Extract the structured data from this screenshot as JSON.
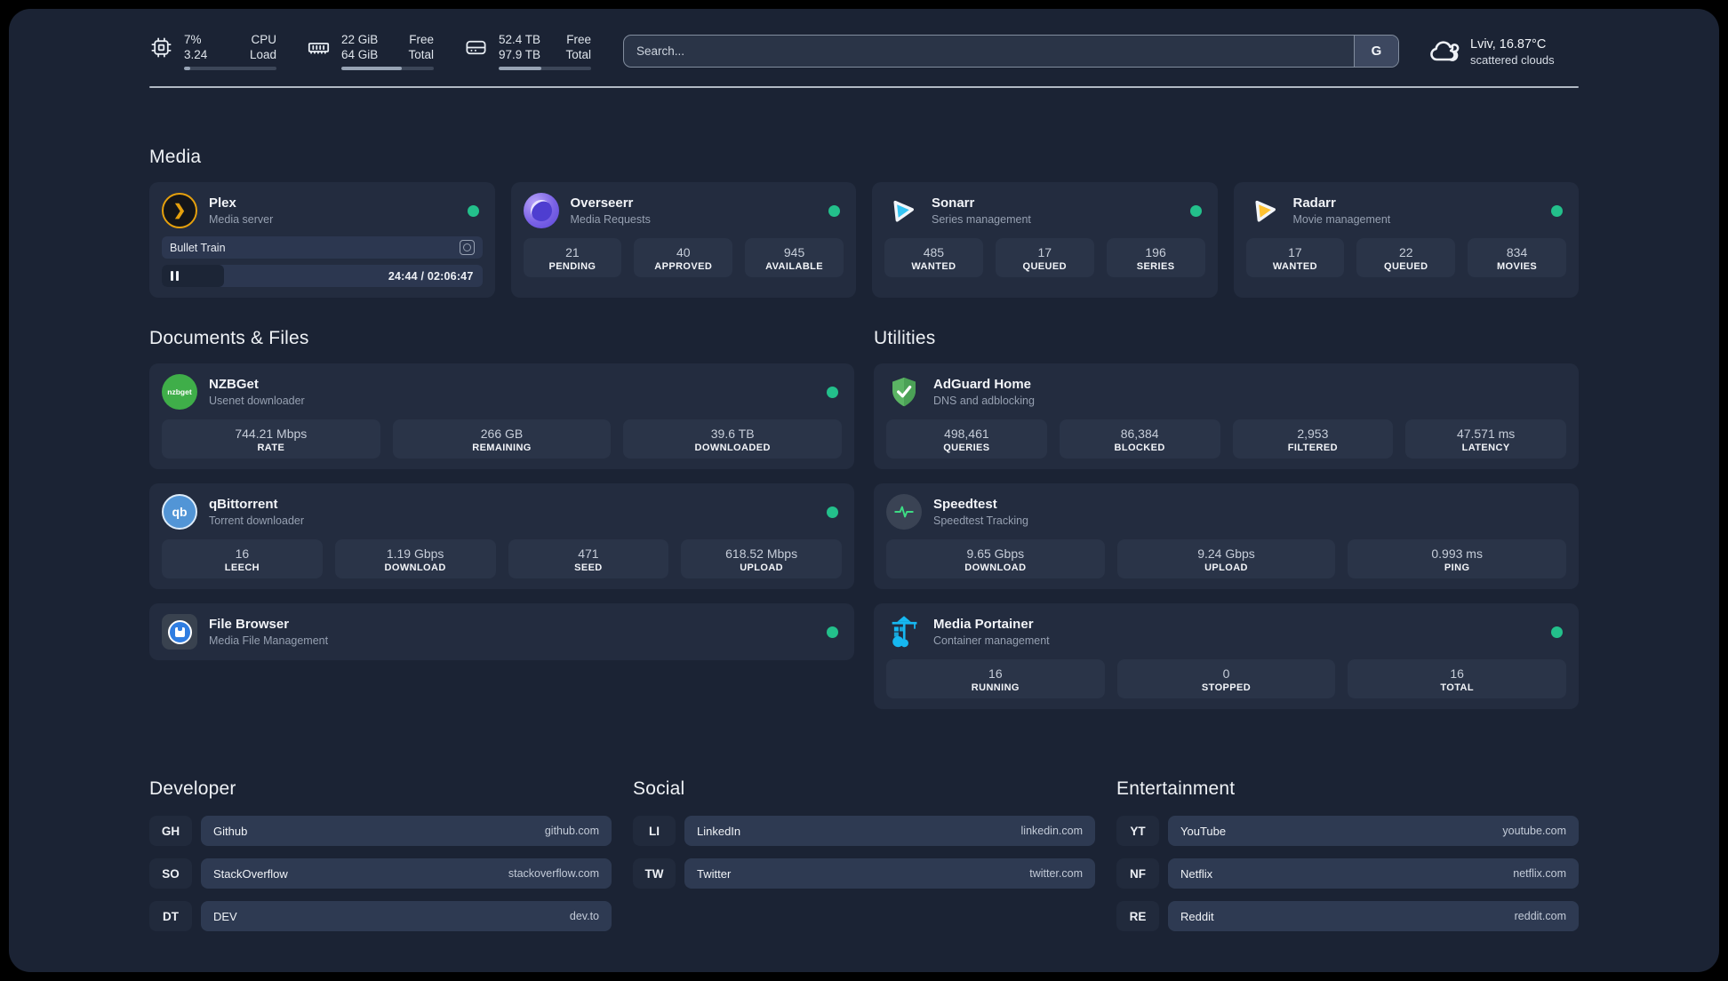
{
  "topbar": {
    "stats": [
      {
        "icon": "cpu-icon",
        "value_top": "7%",
        "value_bottom": "3.24",
        "label_top": "CPU",
        "label_bottom": "Load",
        "progress": 7
      },
      {
        "icon": "ram-icon",
        "value_top": "22 GiB",
        "value_bottom": "64 GiB",
        "label_top": "Free",
        "label_bottom": "Total",
        "progress": 65
      },
      {
        "icon": "disk-icon",
        "value_top": "52.4 TB",
        "value_bottom": "97.9 TB",
        "label_top": "Free",
        "label_bottom": "Total",
        "progress": 46
      }
    ],
    "search": {
      "placeholder": "Search...",
      "button_label": "G"
    },
    "weather": {
      "icon": "cloud-icon",
      "location": "Lviv, 16.87°C",
      "condition": "scattered clouds"
    }
  },
  "sections": {
    "media": {
      "title": "Media",
      "plex": {
        "icon": "plex-icon",
        "name": "Plex",
        "subtitle": "Media server",
        "status": "online",
        "now_playing": {
          "title": "Bullet Train",
          "time": "24:44 / 02:06:47",
          "progress": 19.5
        }
      },
      "overseerr": {
        "icon": "overseerr-icon",
        "name": "Overseerr",
        "subtitle": "Media Requests",
        "status": "online",
        "stats": [
          {
            "value": "21",
            "label": "PENDING"
          },
          {
            "value": "40",
            "label": "APPROVED"
          },
          {
            "value": "945",
            "label": "AVAILABLE"
          }
        ]
      },
      "sonarr": {
        "icon": "sonarr-icon",
        "name": "Sonarr",
        "subtitle": "Series management",
        "status": "online",
        "stats": [
          {
            "value": "485",
            "label": "WANTED"
          },
          {
            "value": "17",
            "label": "QUEUED"
          },
          {
            "value": "196",
            "label": "SERIES"
          }
        ]
      },
      "radarr": {
        "icon": "radarr-icon",
        "name": "Radarr",
        "subtitle": "Movie management",
        "status": "online",
        "stats": [
          {
            "value": "17",
            "label": "WANTED"
          },
          {
            "value": "22",
            "label": "QUEUED"
          },
          {
            "value": "834",
            "label": "MOVIES"
          }
        ]
      }
    },
    "documents": {
      "title": "Documents & Files",
      "nzbget": {
        "icon": "nzbget-icon",
        "icon_text": "nzbget",
        "name": "NZBGet",
        "subtitle": "Usenet downloader",
        "status": "online",
        "stats": [
          {
            "value": "744.21 Mbps",
            "label": "RATE"
          },
          {
            "value": "266 GB",
            "label": "REMAINING"
          },
          {
            "value": "39.6 TB",
            "label": "DOWNLOADED"
          }
        ]
      },
      "qbittorrent": {
        "icon": "qbittorrent-icon",
        "icon_text": "qb",
        "name": "qBittorrent",
        "subtitle": "Torrent downloader",
        "status": "online",
        "stats": [
          {
            "value": "16",
            "label": "LEECH"
          },
          {
            "value": "1.19 Gbps",
            "label": "DOWNLOAD"
          },
          {
            "value": "471",
            "label": "SEED"
          },
          {
            "value": "618.52 Mbps",
            "label": "UPLOAD"
          }
        ]
      },
      "filebrowser": {
        "icon": "filebrowser-icon",
        "name": "File Browser",
        "subtitle": "Media File Management",
        "status": "online"
      }
    },
    "utilities": {
      "title": "Utilities",
      "adguard": {
        "icon": "adguard-icon",
        "name": "AdGuard Home",
        "subtitle": "DNS and adblocking",
        "stats": [
          {
            "value": "498,461",
            "label": "QUERIES"
          },
          {
            "value": "86,384",
            "label": "BLOCKED"
          },
          {
            "value": "2,953",
            "label": "FILTERED"
          },
          {
            "value": "47.571 ms",
            "label": "LATENCY"
          }
        ]
      },
      "speedtest": {
        "icon": "speedtest-icon",
        "name": "Speedtest",
        "subtitle": "Speedtest Tracking",
        "stats": [
          {
            "value": "9.65 Gbps",
            "label": "DOWNLOAD"
          },
          {
            "value": "9.24 Gbps",
            "label": "UPLOAD"
          },
          {
            "value": "0.993 ms",
            "label": "PING"
          }
        ]
      },
      "portainer": {
        "icon": "portainer-icon",
        "name": "Media Portainer",
        "subtitle": "Container management",
        "status": "online",
        "stats": [
          {
            "value": "16",
            "label": "RUNNING"
          },
          {
            "value": "0",
            "label": "STOPPED"
          },
          {
            "value": "16",
            "label": "TOTAL"
          }
        ]
      }
    }
  },
  "links": {
    "developer": {
      "title": "Developer",
      "items": [
        {
          "abbr": "GH",
          "name": "Github",
          "url": "github.com"
        },
        {
          "abbr": "SO",
          "name": "StackOverflow",
          "url": "stackoverflow.com"
        },
        {
          "abbr": "DT",
          "name": "DEV",
          "url": "dev.to"
        }
      ]
    },
    "social": {
      "title": "Social",
      "items": [
        {
          "abbr": "LI",
          "name": "LinkedIn",
          "url": "linkedin.com"
        },
        {
          "abbr": "TW",
          "name": "Twitter",
          "url": "twitter.com"
        }
      ]
    },
    "entertainment": {
      "title": "Entertainment",
      "items": [
        {
          "abbr": "YT",
          "name": "YouTube",
          "url": "youtube.com"
        },
        {
          "abbr": "NF",
          "name": "Netflix",
          "url": "netflix.com"
        },
        {
          "abbr": "RE",
          "name": "Reddit",
          "url": "reddit.com"
        }
      ]
    }
  },
  "colors": {
    "status_online": "#23c08b",
    "plex_accent": "#e5a00d",
    "sonarr_accent": "#35c5f4",
    "radarr_accent": "#ffc230",
    "adguard_accent": "#5bb464",
    "portainer_accent": "#16b8f1",
    "speedtest_accent": "#3ddc84"
  }
}
